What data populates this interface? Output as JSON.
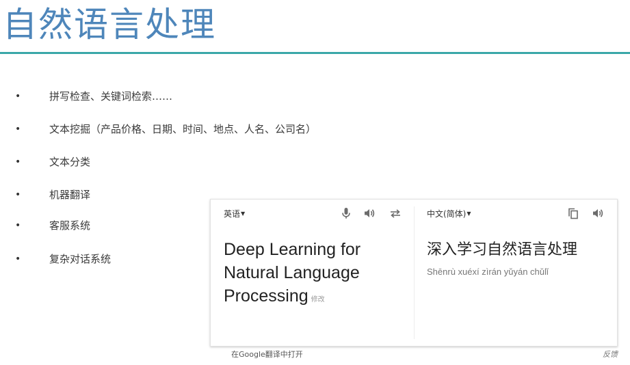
{
  "slide": {
    "title": "自然语言处理"
  },
  "bullets": [
    {
      "marker": "•",
      "text": "拼写检查、关键词检索……"
    },
    {
      "marker": "•",
      "text": "文本挖掘（产品价格、日期、时间、地点、人名、公司名）"
    },
    {
      "marker": "•",
      "text": "文本分类"
    },
    {
      "marker": "•",
      "text": "机器翻译"
    },
    {
      "marker": "•",
      "text": "客服系统"
    },
    {
      "marker": "•",
      "text": "复杂对话系统"
    }
  ],
  "translate": {
    "source_lang": "英语",
    "target_lang": "中文(简体)",
    "source_text": "Deep Learning for Natural Language Processing",
    "edit_label": "修改",
    "target_text": "深入学习自然语言处理",
    "pinyin": "Shēnrù xuéxí zìrán yǔyán chǔlǐ",
    "open_link": "在Google翻译中打开",
    "feedback": "反馈",
    "icons": {
      "mic": "microphone-icon",
      "speaker": "speaker-icon",
      "swap": "swap-languages-icon",
      "copy": "copy-icon"
    },
    "colors": {
      "title": "#4e86ba",
      "rule": "#3aa7a8"
    }
  }
}
